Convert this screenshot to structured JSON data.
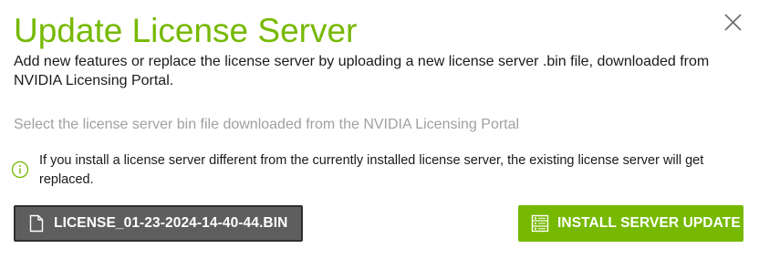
{
  "dialog": {
    "title": "Update License Server",
    "description": "Add new features or replace the license server by uploading a new license server .bin file, downloaded from NVIDIA Licensing Portal.",
    "subtitle": "Select the license server bin file downloaded from the NVIDIA Licensing Portal",
    "info": {
      "icon": "info-circle-icon",
      "text": "If you install a license server different from the currently installed license server, the existing license server will get replaced."
    },
    "file_button": {
      "icon": "file-icon",
      "label": "LICENSE_01-23-2024-14-40-44.BIN"
    },
    "install_button": {
      "icon": "server-icon",
      "label": "INSTALL SERVER UPDATE"
    },
    "close_icon": "close-icon"
  },
  "colors": {
    "accent": "#76b900",
    "file_button_bg": "#5e5e5e",
    "subtitle_text": "#a0a0a0"
  }
}
